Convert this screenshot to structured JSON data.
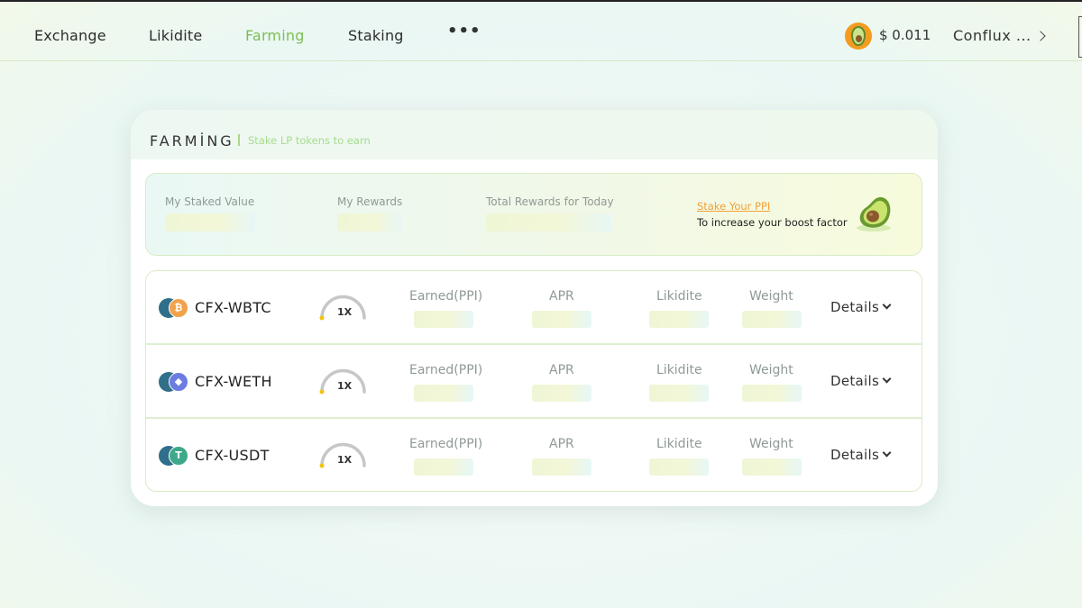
{
  "nav": {
    "items": [
      {
        "label": "Exchange",
        "active": false
      },
      {
        "label": "Likidite",
        "active": false
      },
      {
        "label": "Farming",
        "active": true
      },
      {
        "label": "Staking",
        "active": false
      }
    ],
    "more_label": "•••",
    "token_icon": "avocado-icon",
    "price": "$ 0.011",
    "network": "Conflux ..."
  },
  "card": {
    "title": "FARMİNG",
    "subtitle": "Stake LP tokens to earn",
    "summary": {
      "staked_label": "My Staked Value",
      "rewards_label": "My Rewards",
      "today_label": "Total Rewards for Today",
      "stake_link": "Stake Your PPI",
      "stake_note": "To increase your boost factor"
    },
    "columns": {
      "earned": "Earned(PPI)",
      "apr": "APR",
      "likidite": "Likidite",
      "weight": "Weight"
    },
    "rows": [
      {
        "pair": "CFX-WBTC",
        "boost": "1X",
        "details": "Details",
        "token_b_glyph": "₿",
        "token_b_color": "#f2a24a"
      },
      {
        "pair": "CFX-WETH",
        "boost": "1X",
        "details": "Details",
        "token_b_glyph": "◆",
        "token_b_color": "#6b7de0"
      },
      {
        "pair": "CFX-USDT",
        "boost": "1X",
        "details": "Details",
        "token_b_glyph": "T",
        "token_b_color": "#3fa88a"
      }
    ]
  },
  "colors": {
    "accent": "#7cbf54",
    "link": "#f0a13a",
    "muted": "#8f9a96"
  }
}
